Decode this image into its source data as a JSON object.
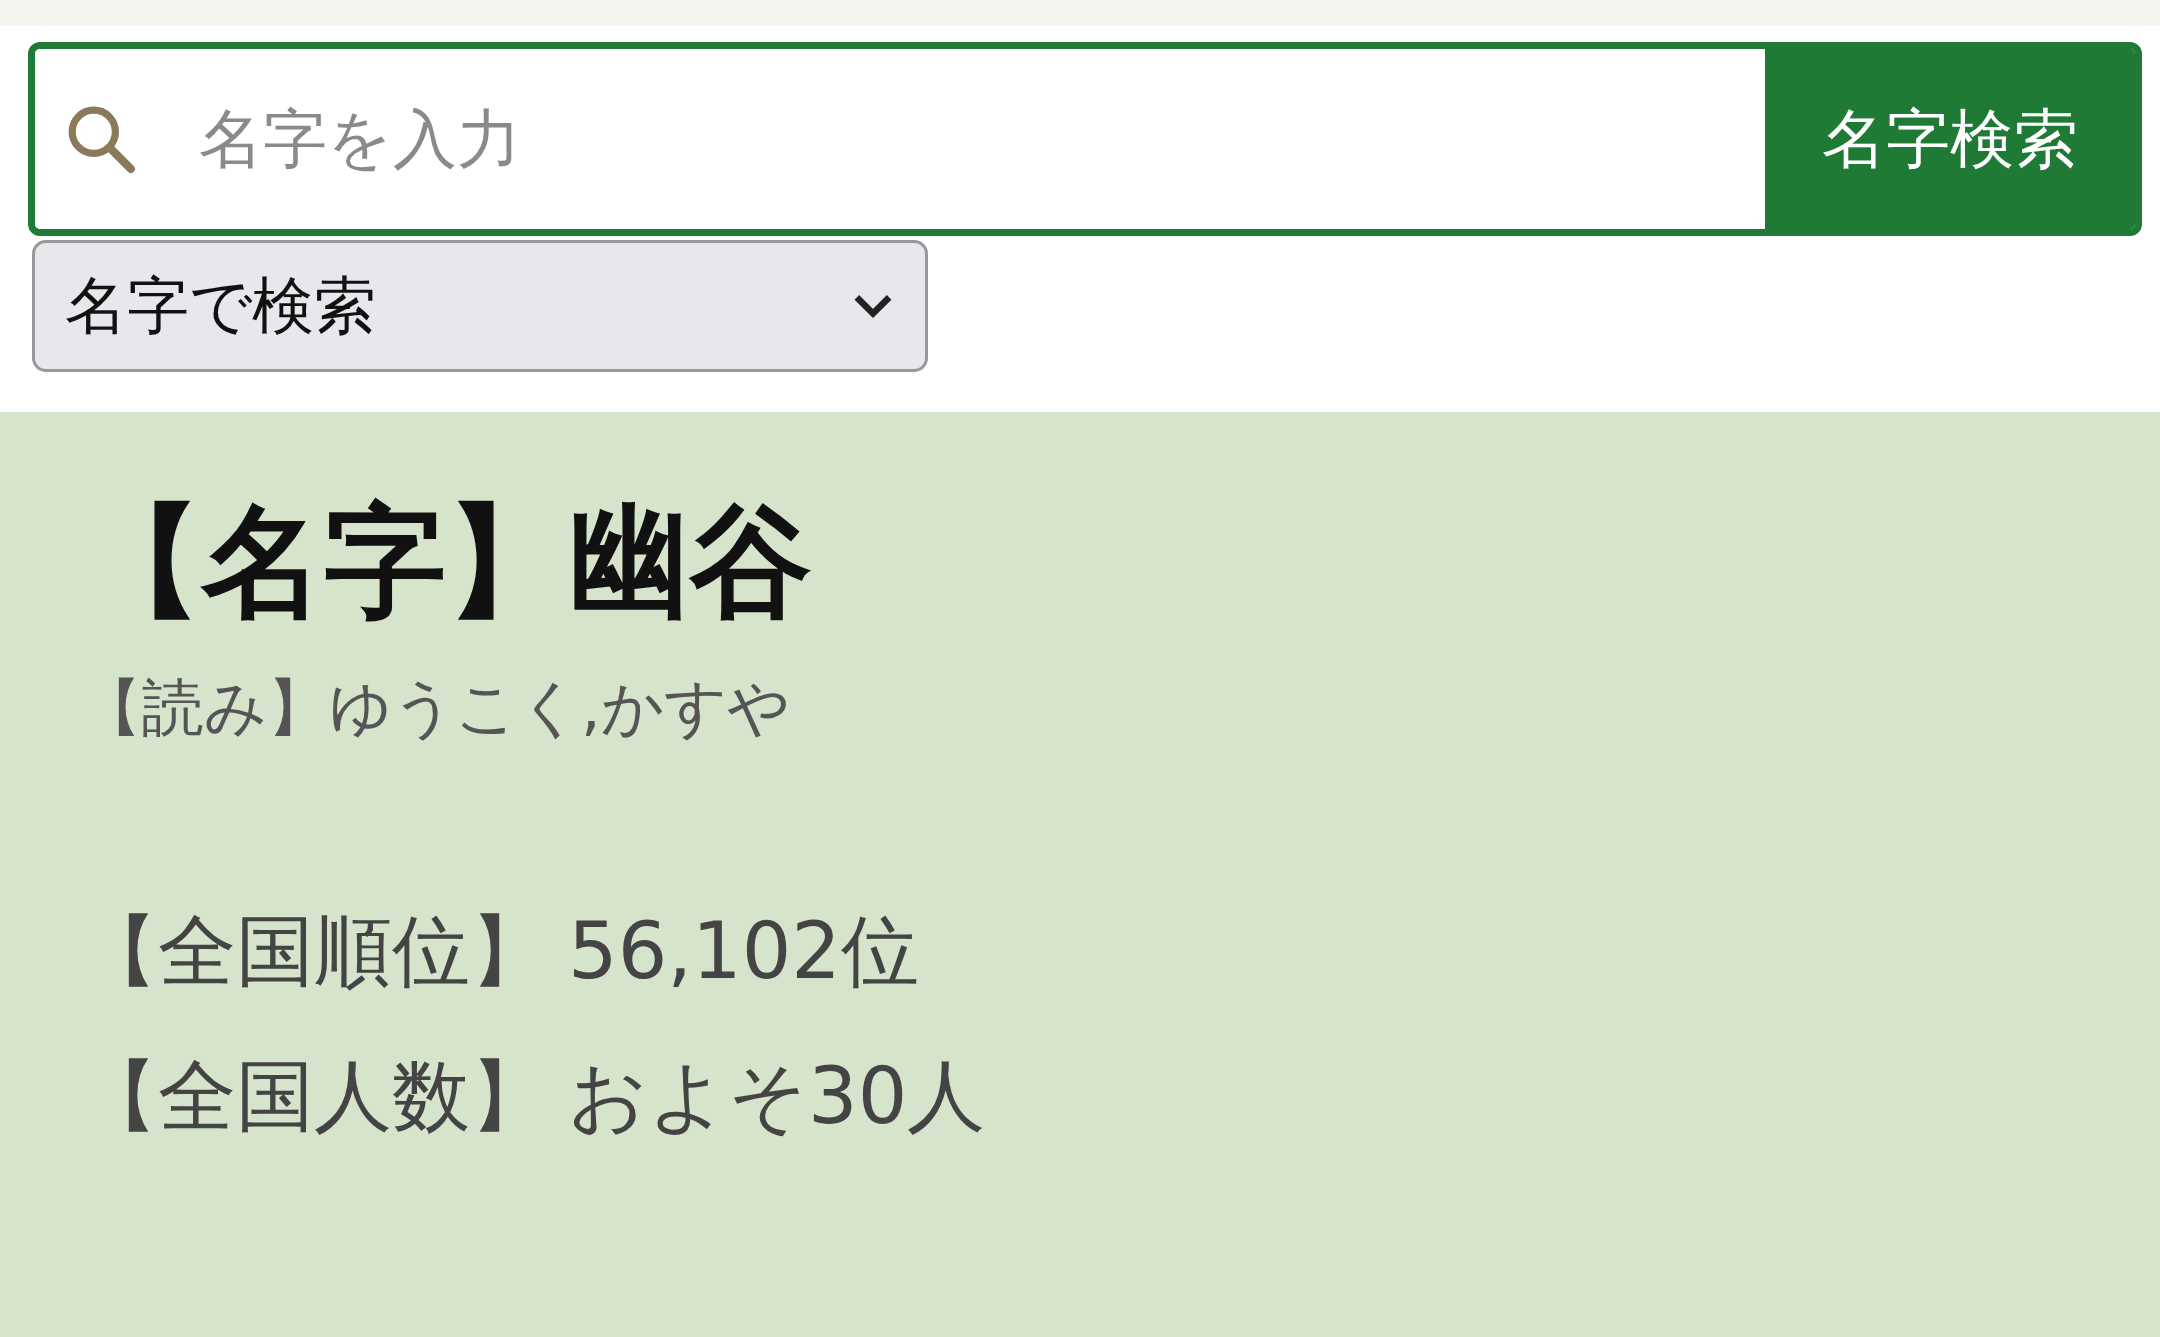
{
  "search": {
    "placeholder": "名字を入力",
    "button": "名字検索"
  },
  "mode_select": {
    "value": "名字で検索"
  },
  "result": {
    "title": "【名字】幽谷",
    "reading": "【読み】ゆうこく,かすや",
    "stats": [
      {
        "label": "【全国順位】",
        "value": "56,102位"
      },
      {
        "label": "【全国人数】",
        "value": "およそ30人"
      }
    ]
  }
}
